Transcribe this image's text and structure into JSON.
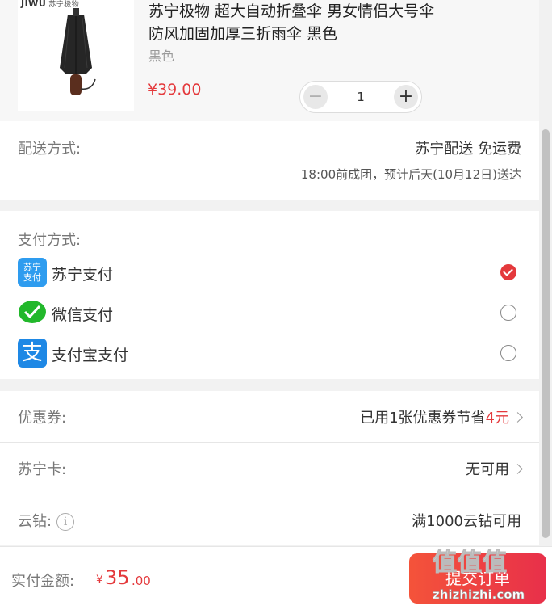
{
  "product": {
    "brand": "JIWU",
    "brand_cn": "苏宁极物",
    "title": "苏宁极物 超大自动折叠伞 男女情侣大号伞 防风加固加厚三折雨伞 黑色",
    "spec": "黑色",
    "price": "¥39.00",
    "quantity": "1",
    "minus_symbol": "−",
    "plus_symbol": "+"
  },
  "delivery": {
    "label": "配送方式:",
    "method": "苏宁配送  免运费",
    "eta": "18:00前成团，预计后天(10月12日)送达"
  },
  "payment": {
    "label": "支付方式:",
    "methods": [
      {
        "name": "苏宁支付",
        "icon": "suning-pay-icon",
        "icon_text": "苏宁支付",
        "color": "#2e9cef",
        "checked": true
      },
      {
        "name": "微信支付",
        "icon": "wechat-pay-icon",
        "color": "#22b82b",
        "checked": false
      },
      {
        "name": "支付宝支付",
        "icon": "alipay-icon",
        "icon_text": "支",
        "color": "#1e88e5",
        "checked": false
      }
    ]
  },
  "discounts": {
    "coupon_label": "优惠券:",
    "coupon_value_prefix": "已用1张优惠券节省",
    "coupon_saving": "4元",
    "card_label": "苏宁卡:",
    "card_value": "无可用",
    "diamond_label": "云钻:",
    "diamond_info": "i",
    "diamond_value": "满1000云钻可用"
  },
  "footer": {
    "total_label": "实付金额:",
    "currency": "¥",
    "amount_int": "35",
    "amount_dec": ".00",
    "submit_label": "提交订单",
    "watermark_top": "值值值",
    "watermark_bottom": "zhizhizhi.com"
  },
  "colors": {
    "accent": "#e4393c",
    "submit_start": "#f4533a",
    "submit_end": "#e8304a"
  }
}
